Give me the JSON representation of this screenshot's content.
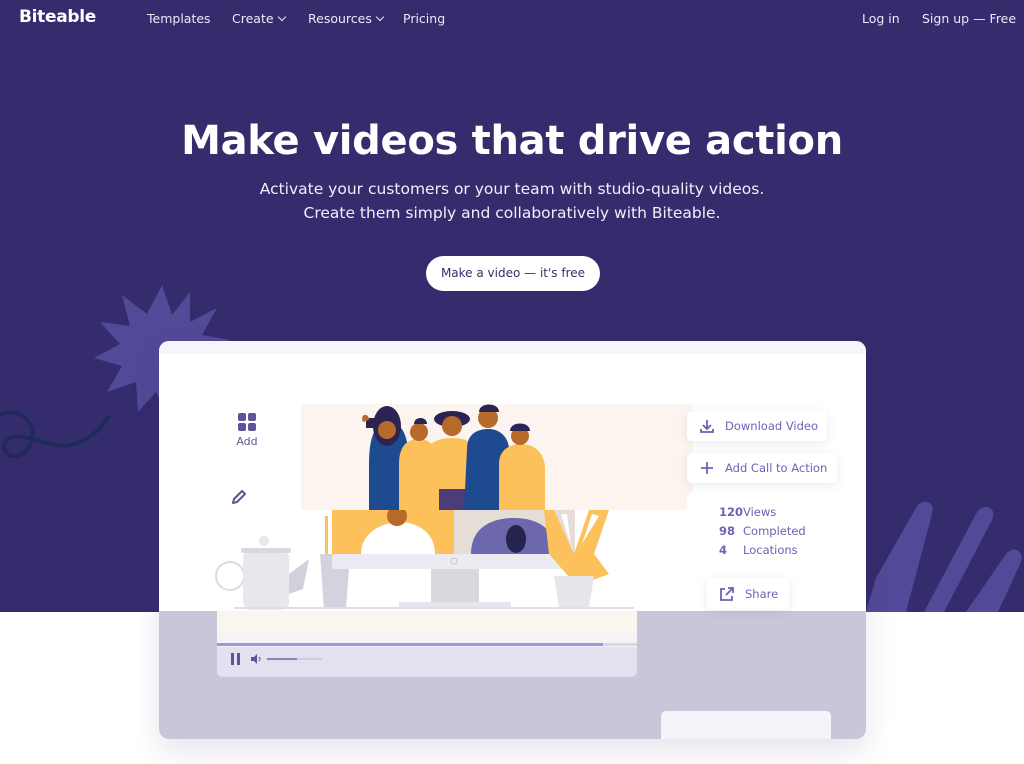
{
  "nav": {
    "logo": "Biteable",
    "items": [
      {
        "label": "Templates",
        "dropdown": false
      },
      {
        "label": "Create",
        "dropdown": true
      },
      {
        "label": "Resources",
        "dropdown": true
      },
      {
        "label": "Pricing",
        "dropdown": false
      }
    ],
    "login": "Log in",
    "signup": "Sign up — Free"
  },
  "hero": {
    "headline": "Make videos that drive action",
    "subline_1": "Activate your customers or your team with studio-quality videos.",
    "subline_2": "Create them simply and collaboratively with Biteable.",
    "cta": "Make a video — it's free"
  },
  "editor": {
    "tools": [
      {
        "icon": "grid-icon",
        "label": "Add"
      },
      {
        "icon": "pencil-icon",
        "label": ""
      }
    ],
    "player": {
      "progress": 0.92,
      "volume": 0.55
    },
    "actions": {
      "download": "Download Video",
      "call_to_action": "Add Call to Action",
      "share": "Share"
    },
    "stats": [
      {
        "value": "120",
        "label": "Views"
      },
      {
        "value": "98",
        "label": "Completed"
      },
      {
        "value": "4",
        "label": "Locations"
      }
    ]
  },
  "colors": {
    "hero_bg": "#352c6e",
    "accent": "#6963b8",
    "decor": "#524a98",
    "mock_bottom": "#cac6d9",
    "yellow": "#fcc15a"
  }
}
